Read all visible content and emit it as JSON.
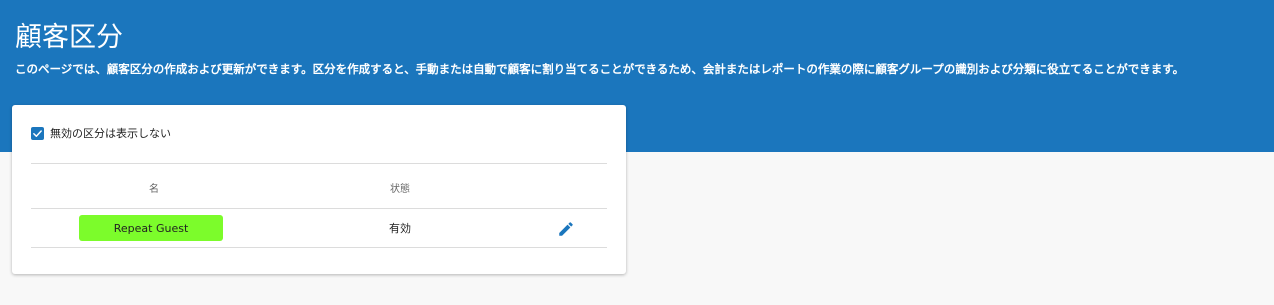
{
  "header": {
    "title": "顧客区分",
    "description": "このページでは、顧客区分の作成および更新ができます。区分を作成すると、手動または自動で顧客に割り当てることができるため、会計またはレポートの作業の際に顧客グループの識別および分類に役立てることができます。"
  },
  "filter": {
    "label": "無効の区分は表示しない",
    "checked": true
  },
  "table": {
    "columns": {
      "name": "名",
      "status": "状態"
    },
    "rows": [
      {
        "name": "Repeat Guest",
        "status": "有効",
        "chip_color": "#7cfc2b",
        "action_icon": "pencil-edit-icon"
      }
    ]
  },
  "colors": {
    "brand": "#1b76bd",
    "background": "#f8f8f8"
  }
}
